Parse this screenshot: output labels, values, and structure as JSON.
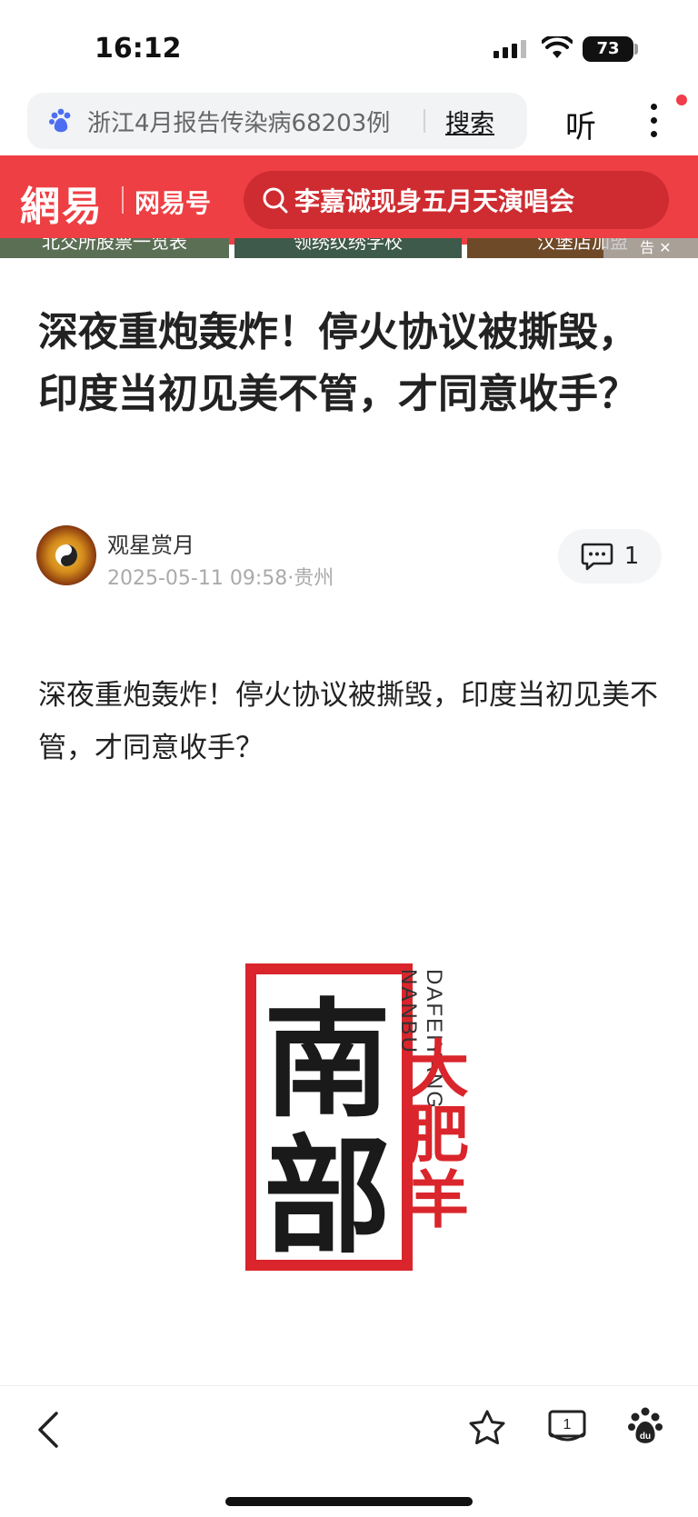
{
  "status_bar": {
    "time": "16:12",
    "battery": "73"
  },
  "browser": {
    "search_query": "浙江4月报告传染病68203例",
    "search_button": "搜索",
    "listen_button": "听"
  },
  "netease": {
    "logo": "網易",
    "channel": "网易号",
    "search_placeholder": "李嘉诚现身五月天演唱会",
    "brand_color": "#ee3f44"
  },
  "ad_strip": {
    "items": [
      "北交所股票一览表",
      "领绣纹绣学校",
      "汉堡店加盟"
    ],
    "close_label": "告"
  },
  "article": {
    "title": "深夜重炮轰炸！停火协议被撕毁，印度当初见美不管，才同意收手？",
    "author": "观星赏月",
    "meta": "2025-05-11 09:58·贵州",
    "comment_count": "1",
    "body": "深夜重炮轰炸！停火协议被撕毁，印度当初见美不管，才同意收手？",
    "image": {
      "vertical_text": "南部",
      "side_text": "大肥羊",
      "latin_text_1": "DAFEIYANG",
      "latin_text_2": "NANBU",
      "accent_color": "#d9252b"
    }
  },
  "bottom_bar": {
    "tabs_count": "1"
  }
}
